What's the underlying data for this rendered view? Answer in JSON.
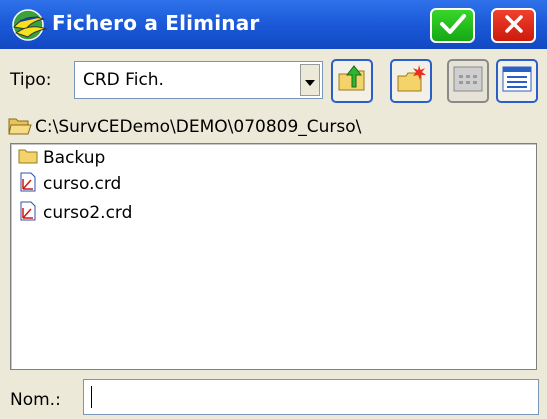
{
  "window": {
    "title": "Fichero a Eliminar",
    "title_bar_color": "#1a57d6",
    "ok_icon": "check-icon",
    "close_icon": "close-x-icon"
  },
  "filter": {
    "label": "Tipo:",
    "selected": "CRD Fich."
  },
  "toolbar": {
    "buttons": [
      {
        "icon": "folder-up-icon",
        "enabled": true
      },
      {
        "icon": "new-folder-icon",
        "enabled": true
      },
      {
        "icon": "icon-view-icon",
        "enabled": false
      },
      {
        "icon": "detail-view-icon",
        "enabled": true
      }
    ]
  },
  "current_path": "C:\\SurvCEDemo\\DEMO\\070809_Curso\\",
  "files": [
    {
      "name": "Backup",
      "icon": "folder-icon"
    },
    {
      "name": "curso.crd",
      "icon": "crd-file-icon"
    },
    {
      "name": "curso2.crd",
      "icon": "crd-file-icon"
    }
  ],
  "name_field": {
    "label": "Nom.:",
    "value": ""
  }
}
